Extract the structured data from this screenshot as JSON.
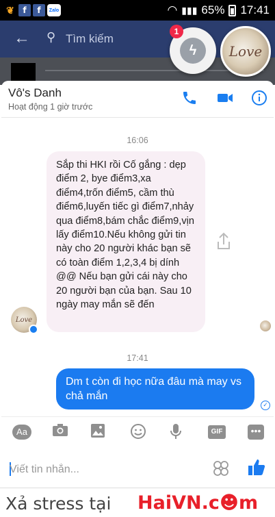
{
  "status_bar": {
    "battery": "65%",
    "time": "17:41",
    "zalo_label": "Zalo"
  },
  "search": {
    "placeholder": "Tìm kiếm"
  },
  "chat_heads": {
    "badge_count": "1",
    "avatar_text": "Love"
  },
  "contact": {
    "name": "Vô's Danh",
    "status": "Hoạt động 1 giờ trước"
  },
  "messages": {
    "time_1": "16:06",
    "incoming_text": "Sắp thi HKI rồi Cố gắng : dẹp điểm 2, bye điểm3,xa điểm4,trốn điểm5, cầm thù điểm6,luyến tiếc gì điểm7,nhảy qua điểm8,bám chắc điểm9,vịn lấy điểm10.Nếu không gửi tin này cho 20 người khác bạn sẽ có toàn điểm 1,2,3,4 bị dính @@ Nếu bạn gửi cái này cho 20 người bạn của bạn. Sau 10 ngày may mắn sẽ đến",
    "time_2": "17:41",
    "outgoing_text": "Dm  t còn  đi học nữa  đâu mà may vs chả mắn"
  },
  "toolbar": {
    "aa_label": "Aa",
    "gif_label": "GIF",
    "more_label": "•••"
  },
  "composer": {
    "placeholder": "Viết tin nhắn..."
  },
  "watermark": {
    "prefix": "Xả stress tại",
    "brand": "HaiVN.c☻m"
  },
  "colors": {
    "accent": "#1b7bf0",
    "header": "#2b3d6e",
    "incoming_bubble": "#f8eff5"
  }
}
